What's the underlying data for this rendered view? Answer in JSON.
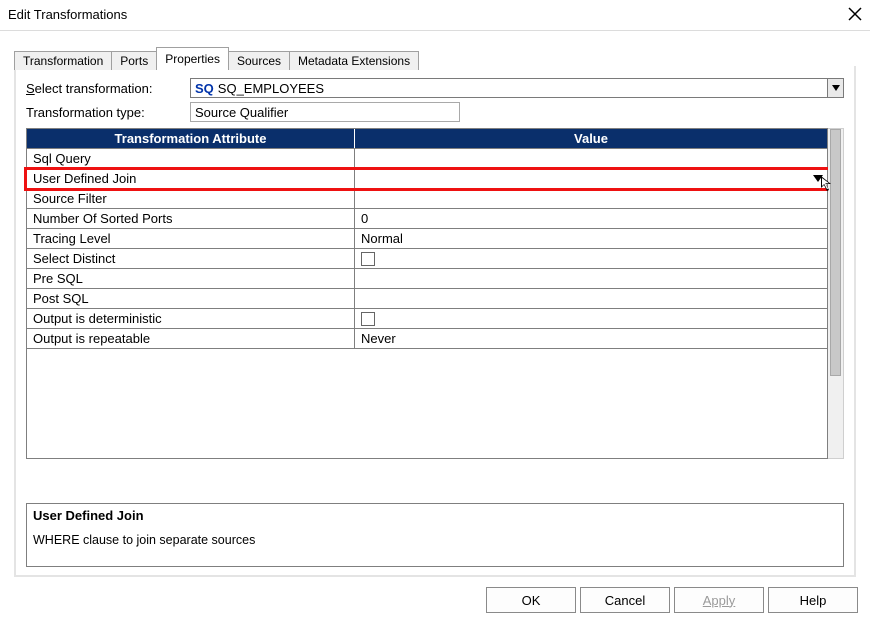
{
  "window": {
    "title": "Edit Transformations"
  },
  "tabs": [
    "Transformation",
    "Ports",
    "Properties",
    "Sources",
    "Metadata Extensions"
  ],
  "active_tab_index": 2,
  "select_transformation": {
    "label_pre": "S",
    "label_rest": "elect transformation:",
    "prefix": "SQ",
    "value": "SQ_EMPLOYEES"
  },
  "transformation_type": {
    "label": "Transformation type:",
    "value": "Source Qualifier"
  },
  "grid": {
    "headers": {
      "attr": "Transformation Attribute",
      "val": "Value"
    },
    "rows": [
      {
        "attr": "Sql Query",
        "val": "",
        "kind": "text"
      },
      {
        "attr": "User Defined Join",
        "val": "",
        "kind": "dropdown",
        "selected": true
      },
      {
        "attr": "Source Filter",
        "val": "",
        "kind": "text"
      },
      {
        "attr": "Number Of Sorted Ports",
        "val": "0",
        "kind": "text"
      },
      {
        "attr": "Tracing Level",
        "val": "Normal",
        "kind": "text"
      },
      {
        "attr": "Select Distinct",
        "val": "",
        "kind": "check"
      },
      {
        "attr": "Pre SQL",
        "val": "",
        "kind": "text"
      },
      {
        "attr": "Post SQL",
        "val": "",
        "kind": "text"
      },
      {
        "attr": "Output is deterministic",
        "val": "",
        "kind": "check"
      },
      {
        "attr": "Output is repeatable",
        "val": "Never",
        "kind": "text"
      }
    ]
  },
  "description": {
    "title": "User Defined Join",
    "text": "WHERE clause to join separate sources"
  },
  "buttons": {
    "ok": "OK",
    "cancel": "Cancel",
    "apply": "Apply",
    "help": "Help"
  }
}
